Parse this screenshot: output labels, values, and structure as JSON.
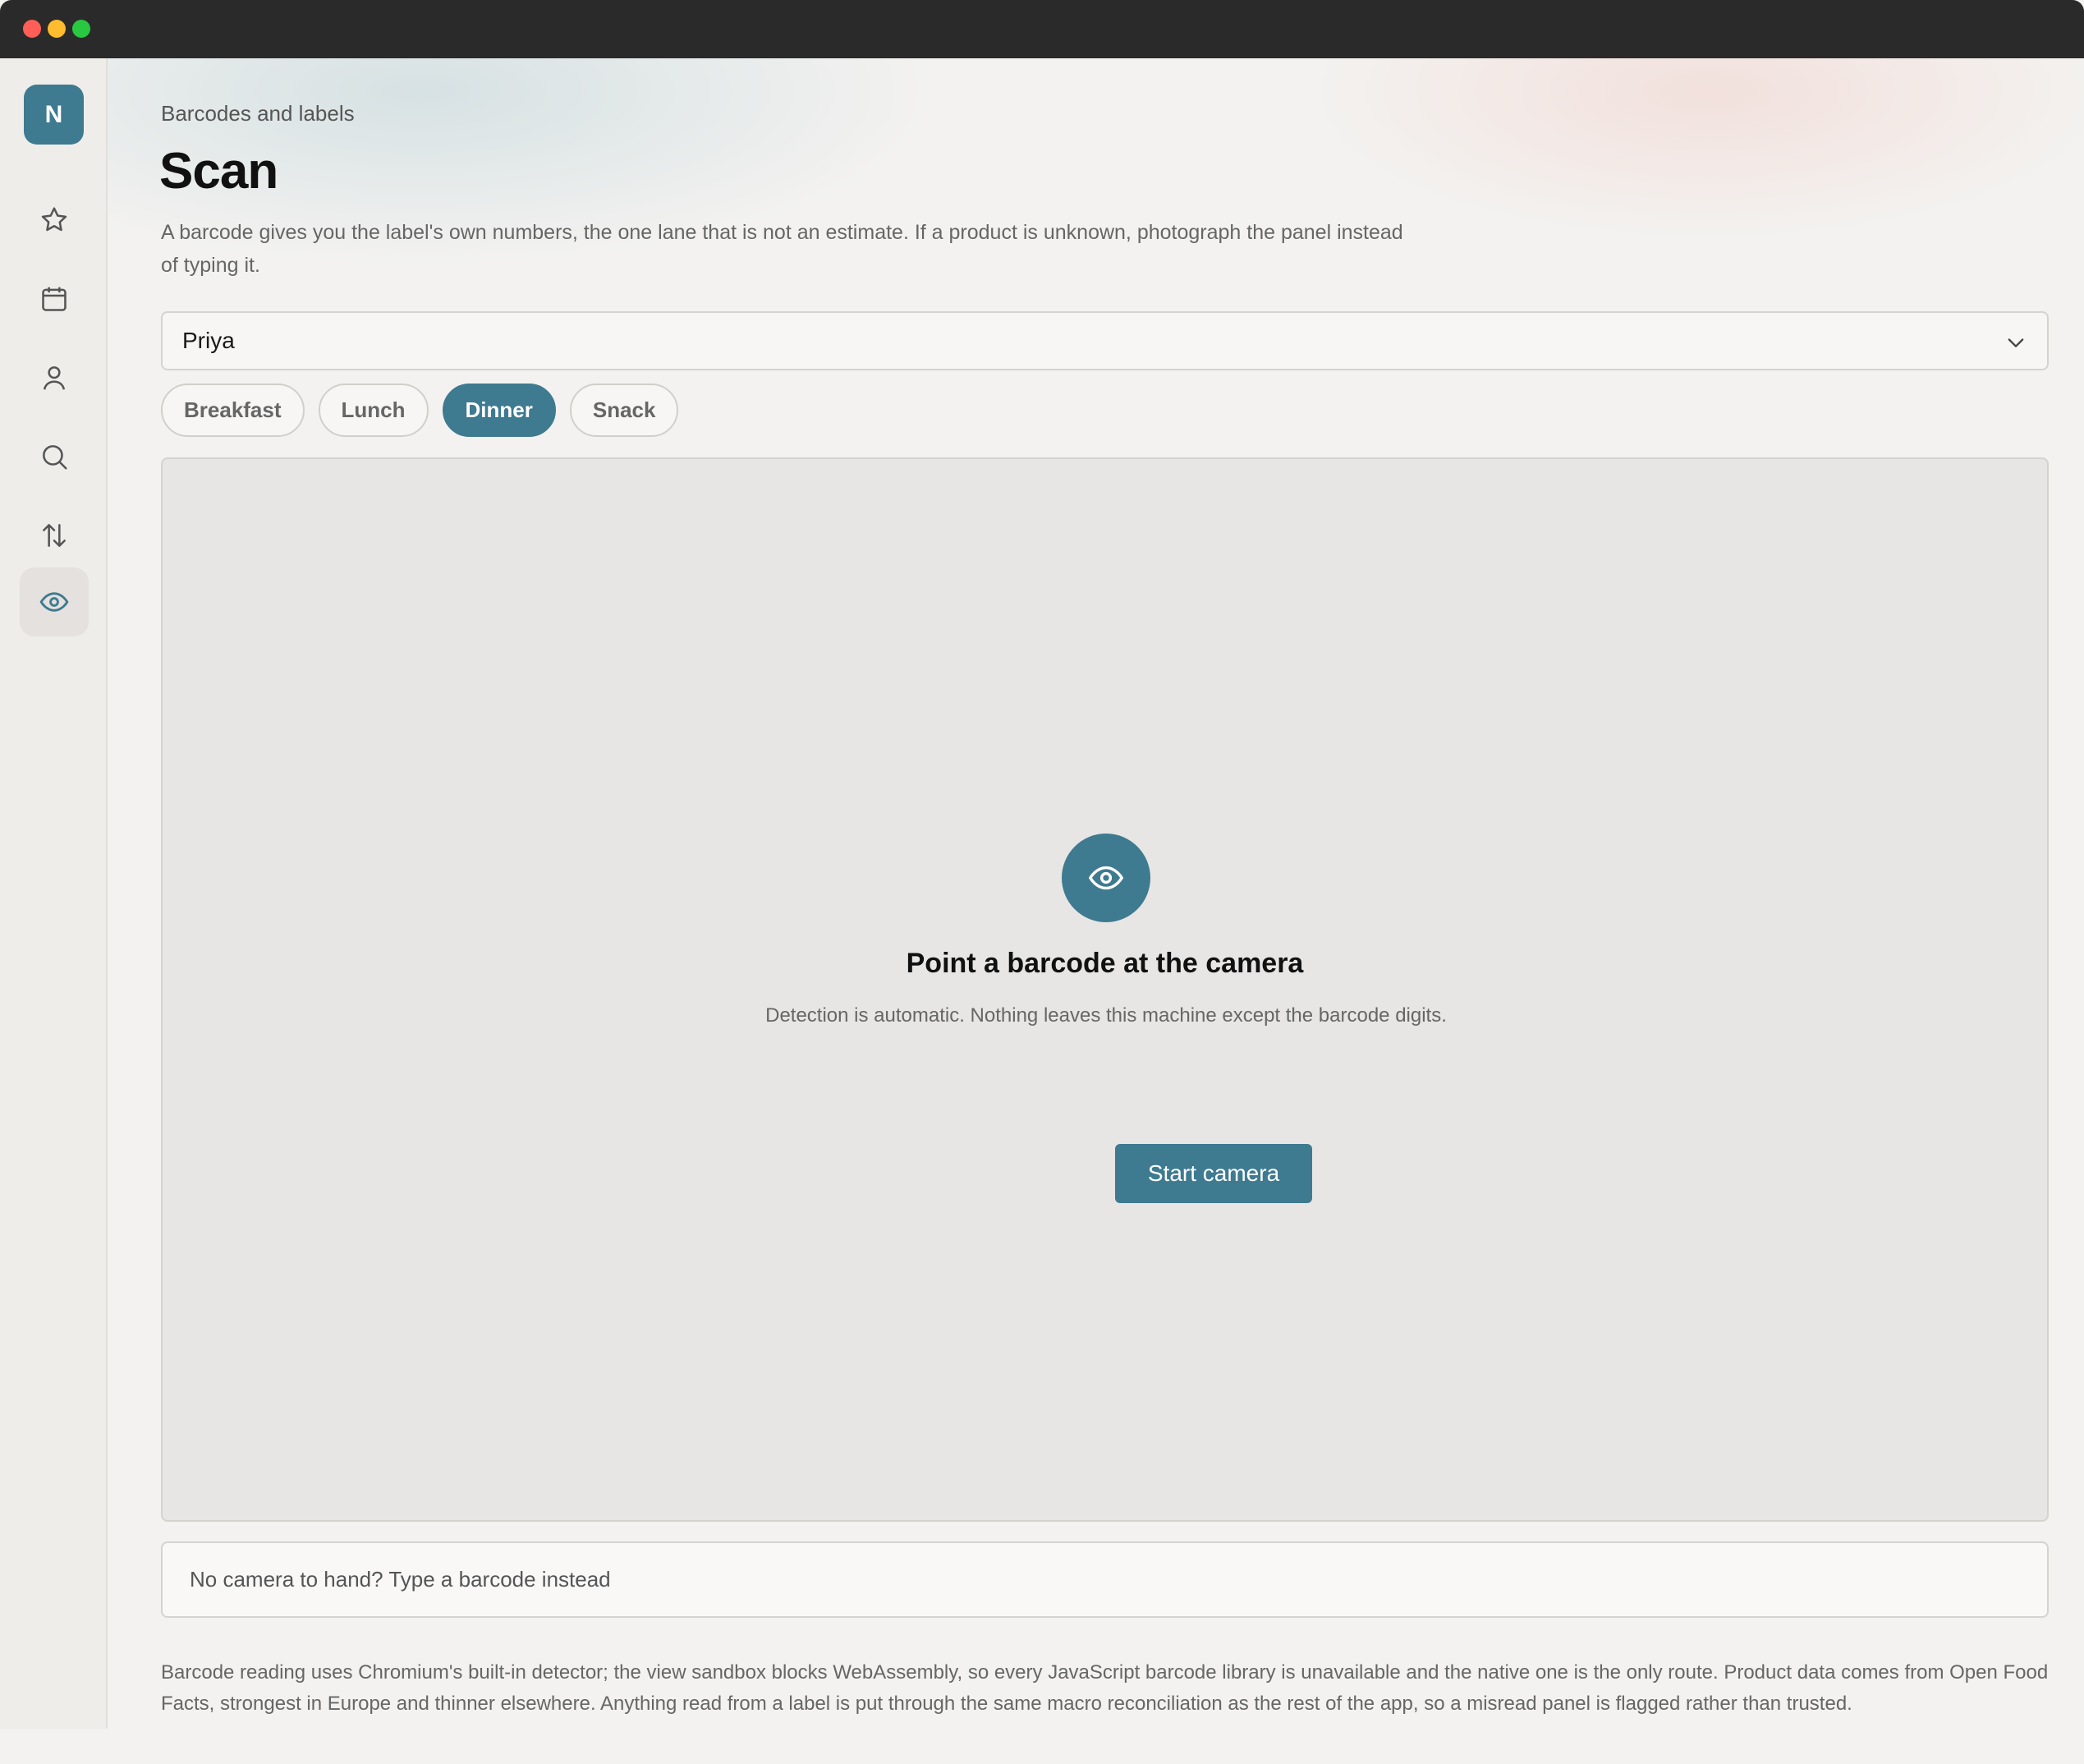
{
  "window": {
    "traffic_lights": [
      "#ff5f57",
      "#febc2e",
      "#28c840"
    ]
  },
  "sidebar": {
    "avatar_initial": "N",
    "accent": "#3e7a90",
    "items": [
      {
        "icon": "star-icon",
        "active": false
      },
      {
        "icon": "calendar-icon",
        "active": false
      },
      {
        "icon": "person-icon",
        "active": false
      },
      {
        "icon": "search-icon",
        "active": false
      },
      {
        "icon": "sort-arrows-icon",
        "active": false
      },
      {
        "icon": "eye-icon",
        "active": true
      }
    ]
  },
  "header": {
    "eyebrow": "Barcodes and labels",
    "title": "Scan",
    "intro": "A barcode gives you the label's own numbers, the one lane that is not an estimate. If a product is unknown, photograph the panel instead of typing it."
  },
  "person_select": {
    "value": "Priya"
  },
  "meals": {
    "options": [
      "Breakfast",
      "Lunch",
      "Dinner",
      "Snack"
    ],
    "selected": "Dinner"
  },
  "camera": {
    "icon": "eye-icon",
    "title": "Point a barcode at the camera",
    "description": "Detection is automatic. Nothing leaves this machine except the barcode digits.",
    "start_label": "Start camera"
  },
  "barcode_input": {
    "placeholder": "No camera to hand? Type a barcode instead"
  },
  "footnote": "Barcode reading uses Chromium's built-in detector; the view sandbox blocks WebAssembly, so every JavaScript barcode library is unavailable and the native one is the only route. Product data comes from Open Food Facts, strongest in Europe and thinner elsewhere. Anything read from a label is put through the same macro reconciliation as the rest of the app, so a misread panel is flagged rather than trusted."
}
